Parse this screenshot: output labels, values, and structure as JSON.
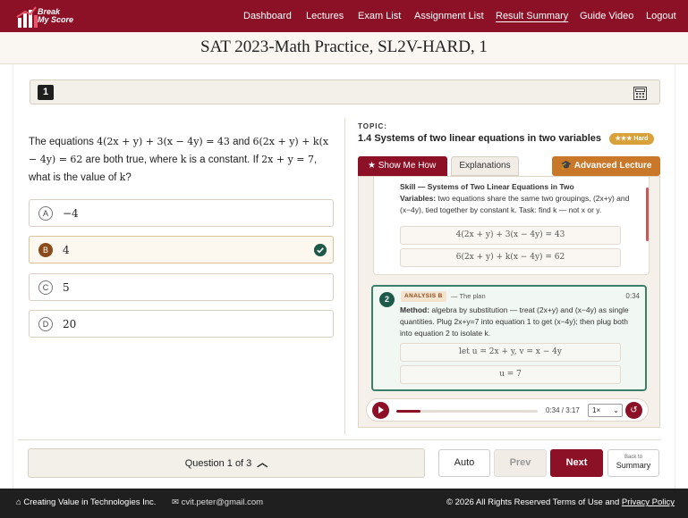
{
  "app": {
    "logo_line1": "Break",
    "logo_line2": "My Score"
  },
  "nav": {
    "items": [
      "Dashboard",
      "Lectures",
      "Exam List",
      "Assignment List",
      "Result Summary",
      "Guide Video",
      "Logout"
    ],
    "active": "Result Summary"
  },
  "page": {
    "title": "SAT 2023-Math Practice, SL2V-HARD, 1"
  },
  "question": {
    "number": "1",
    "text_parts": [
      "The equations ",
      "4(2x + y) + 3(x − 4y) = 43",
      " and ",
      "6(2x + y) + k(x − 4y) = 62",
      " are both true, where ",
      "k",
      " is a constant. If ",
      "2x + y = 7",
      ", what is the value of ",
      "k",
      "?"
    ],
    "choices": [
      {
        "letter": "A",
        "text": "−4",
        "selected": false
      },
      {
        "letter": "B",
        "text": "4",
        "selected": true,
        "correct": true
      },
      {
        "letter": "C",
        "text": "5",
        "selected": false
      },
      {
        "letter": "D",
        "text": "20",
        "selected": false
      }
    ]
  },
  "topic": {
    "label": "TOPIC:",
    "title": "1.4 Systems of two linear equations in two variables",
    "difficulty": "★★★ Hard"
  },
  "tabs": {
    "show_me_how": "Show Me How",
    "explanations": "Explanations",
    "advanced_lecture": "Advanced Lecture"
  },
  "steps": {
    "step1": {
      "heading": "Skill — Systems of Two Linear Equations in Two",
      "bold_lead": "Variables:",
      "body": " two equations share the same two groupings, (2x+y) and (x−4y), tied together by constant k. Task: find k — not x or y.",
      "eq1": "4(2x + y) + 3(x − 4y) = 43",
      "eq2": "6(2x + y) + k(x − 4y) = 62"
    },
    "step2": {
      "number": "2",
      "badge": "ANALYSIS B",
      "subtitle": "— The plan",
      "time": "0:34",
      "bold_lead": "Method:",
      "body": " algebra by substitution — treat (2x+y) and (x−4y) as single quantities. Plug 2x+y=7 into equation 1 to get (x−4y); then plug both into equation 2 to isolate k.",
      "eq1": "let u = 2x + y, v = x − 4y",
      "eq2": "u = 7"
    }
  },
  "player": {
    "time_display": "0:34 / 3:17",
    "progress_fraction": 0.17,
    "speed": "1×"
  },
  "footer_nav": {
    "counter": "Question  1 of 3",
    "auto": "Auto",
    "prev": "Prev",
    "next": "Next",
    "summary_small": "Back to",
    "summary_big": "Summary"
  },
  "footer": {
    "company": "Creating Value in Technologies Inc.",
    "email": "cvit.peter@gmail.com",
    "copyright": "© 2026 All Rights Reserved Terms of Use and ",
    "privacy": "Privacy Policy"
  },
  "colors": {
    "brand": "#8c1026",
    "accent_orange": "#c9782a",
    "correct_green": "#1e5a4a",
    "badge_gold": "#d9a13a"
  }
}
